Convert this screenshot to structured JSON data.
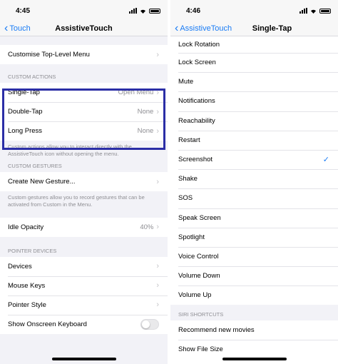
{
  "left": {
    "status": {
      "time": "4:45"
    },
    "nav": {
      "back": "Touch",
      "title": "AssistiveTouch"
    },
    "top_menu": {
      "label": "Customise Top-Level Menu"
    },
    "custom_actions": {
      "header": "CUSTOM ACTIONS",
      "items": [
        {
          "label": "Single-Tap",
          "value": "Open Menu"
        },
        {
          "label": "Double-Tap",
          "value": "None"
        },
        {
          "label": "Long Press",
          "value": "None"
        }
      ],
      "footer": "Custom actions allow you to interact directly with the AssistiveTouch icon without opening the menu."
    },
    "custom_gestures": {
      "header": "CUSTOM GESTURES",
      "item": "Create New Gesture...",
      "footer": "Custom gestures allow you to record gestures that can be activated from Custom in the Menu."
    },
    "idle_opacity": {
      "label": "Idle Opacity",
      "value": "40%"
    },
    "pointer_devices": {
      "header": "POINTER DEVICES",
      "items": [
        "Devices",
        "Mouse Keys",
        "Pointer Style"
      ],
      "keyboard_toggle": {
        "label": "Show Onscreen Keyboard",
        "on": false
      }
    },
    "highlight_color": "#2b2ea6"
  },
  "right": {
    "status": {
      "time": "4:46"
    },
    "nav": {
      "back": "AssistiveTouch",
      "title": "Single-Tap"
    },
    "items": [
      "Lock Rotation",
      "Lock Screen",
      "Mute",
      "Notifications",
      "Reachability",
      "Restart",
      "Screenshot",
      "Shake",
      "SOS",
      "Speak Screen",
      "Spotlight",
      "Voice Control",
      "Volume Down",
      "Volume Up"
    ],
    "selected": "Screenshot",
    "siri": {
      "header": "SIRI SHORTCUTS",
      "items": [
        "Recommend new movies",
        "Show File Size"
      ]
    }
  },
  "colors": {
    "accent": "#1a7cf5",
    "secondary_text": "#8e8e93"
  }
}
